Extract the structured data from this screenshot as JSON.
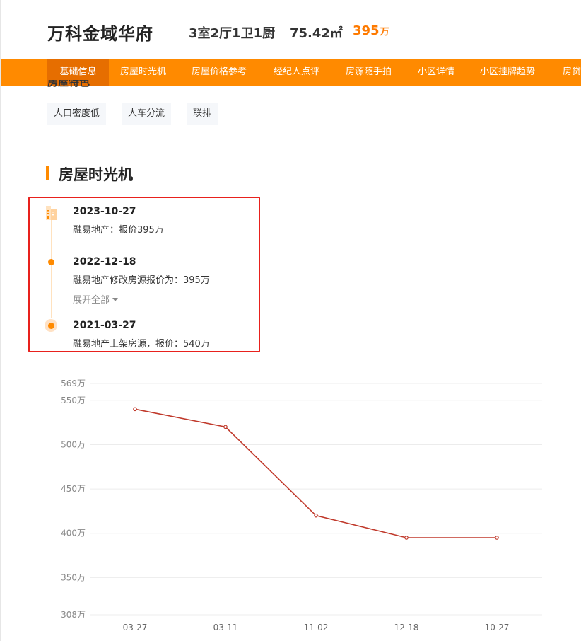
{
  "header": {
    "title": "万科金域华府",
    "layout": "3室2厅1卫1厨",
    "area": "75.42㎡",
    "price": "395",
    "price_unit": "万"
  },
  "nav": {
    "items": [
      "基础信息",
      "房屋时光机",
      "房屋价格参考",
      "经纪人点评",
      "房源随手拍",
      "小区详情",
      "小区挂牌趋势",
      "房贷"
    ]
  },
  "features": {
    "header": "房屋特色",
    "tags": [
      "人口密度低",
      "人车分流",
      "联排"
    ]
  },
  "timemachine": {
    "title": "房屋时光机",
    "expand_label": "展开全部",
    "events": [
      {
        "date": "2023-10-27",
        "desc": "融易地产：报价395万"
      },
      {
        "date": "2022-12-18",
        "desc": "融易地产修改房源报价为：395万"
      },
      {
        "date": "2021-03-27",
        "desc": "融易地产上架房源，报价：540万"
      }
    ]
  },
  "chart_data": {
    "type": "line",
    "categories": [
      "03-27",
      "03-11",
      "11-02",
      "12-18",
      "10-27"
    ],
    "values": [
      540,
      520,
      420,
      395,
      395
    ],
    "y_unit": "万",
    "yticks": [
      308,
      350,
      400,
      450,
      500,
      550,
      569
    ],
    "ylim": [
      308,
      569
    ],
    "grid": true,
    "color": "#c0392b"
  }
}
